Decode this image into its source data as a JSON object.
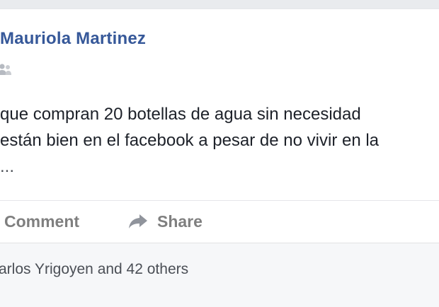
{
  "post": {
    "author_name": "Mauriola Martinez",
    "text_lines": [
      "que compran 20 botellas de agua sin necesidad",
      "están bien en el facebook a pesar de no vivir en la",
      "..."
    ]
  },
  "actions": {
    "comment_label": "Comment",
    "share_label": "Share"
  },
  "reactions": {
    "summary": "arlos Yrigoyen and 42 others"
  },
  "icons": {
    "audience": "friends-icon",
    "share": "share-arrow-icon"
  },
  "colors": {
    "author_link": "#365899",
    "post_text": "#1d2129",
    "action_text": "#7f7f7f",
    "footer_bg": "#f6f7f9"
  }
}
